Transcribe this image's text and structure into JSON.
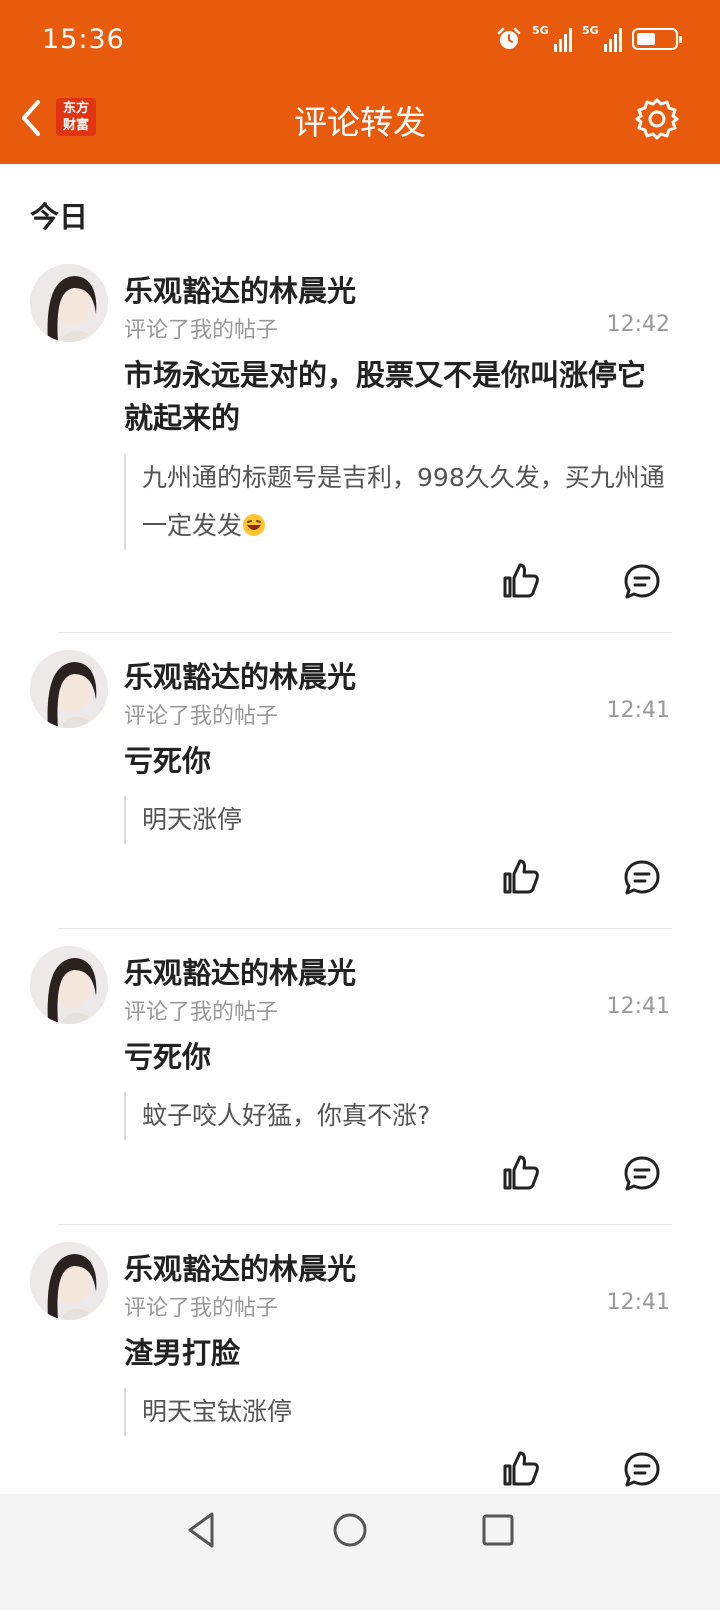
{
  "status_bar": {
    "time": "15:36",
    "signal_label_1": "5G",
    "signal_label_2": "5G",
    "battery_level": 0.5
  },
  "header": {
    "title": "评论转发",
    "logo_line1": "东方",
    "logo_line2": "财富"
  },
  "section": {
    "label": "今日"
  },
  "items": [
    {
      "author": "乐观豁达的林晨光",
      "action": "评论了我的帖子",
      "time": "12:42",
      "text": "市场永远是对的，股票又不是你叫涨停它就起来的",
      "quote": "九州通的标题号是吉利，998久久发，买九州通一定发发",
      "quote_emoji": "laughing-emoji"
    },
    {
      "author": "乐观豁达的林晨光",
      "action": "评论了我的帖子",
      "time": "12:41",
      "text": "亏死你",
      "quote": "明天涨停"
    },
    {
      "author": "乐观豁达的林晨光",
      "action": "评论了我的帖子",
      "time": "12:41",
      "text": "亏死你",
      "quote": "蚊子咬人好猛，你真不涨?"
    },
    {
      "author": "乐观豁达的林晨光",
      "action": "评论了我的帖子",
      "time": "12:41",
      "text": "渣男打脸",
      "quote": "明天宝钛涨停"
    }
  ],
  "colors": {
    "brand": "#E85A0C",
    "logo_bg": "#E03412",
    "muted_text": "#999999"
  }
}
